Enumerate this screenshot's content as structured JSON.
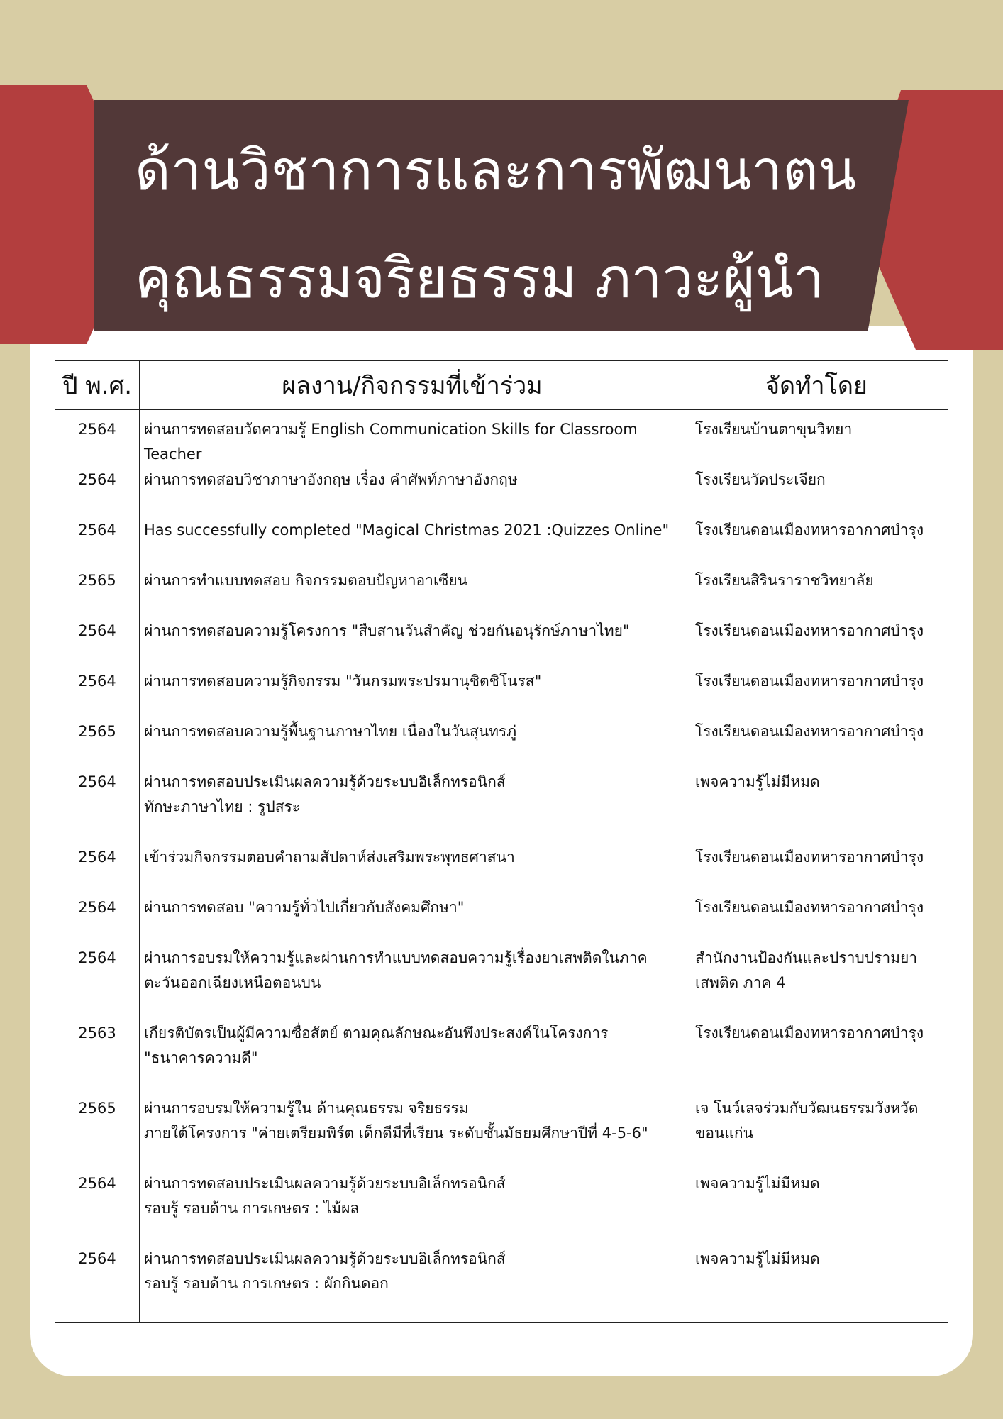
{
  "header": {
    "title_line1": "ด้านวิชาการและการพัฒนาตน",
    "title_line2": "คุณธรรมจริยธรรม ภาวะผู้นำ"
  },
  "table": {
    "columns": [
      "ปี พ.ศ.",
      "ผลงาน/กิจกรรมที่เข้าร่วม",
      "จัดทำโดย"
    ],
    "rows": [
      {
        "year": "2564",
        "activity": [
          "ผ่านการทดสอบวัดความรู้ English Communication Skills for Classroom",
          "Teacher"
        ],
        "organizer": [
          "โรงเรียนบ้านตาขุนวิทยา"
        ]
      },
      {
        "year": "2564",
        "activity": [
          "ผ่านการทดสอบวิชาภาษาอังกฤษ เรื่อง คำศัพท์ภาษาอังกฤษ"
        ],
        "organizer": [
          "โรงเรียนวัดประเจียก"
        ]
      },
      {
        "year": "2564",
        "activity": [
          "Has successfully completed \"Magical Christmas 2021 :Quizzes Online\""
        ],
        "organizer": [
          "โรงเรียนดอนเมืองทหารอากาศบำรุง"
        ]
      },
      {
        "year": "2565",
        "activity": [
          "ผ่านการทำแบบทดสอบ กิจกรรมตอบปัญหาอาเซียน"
        ],
        "organizer": [
          "โรงเรียนสิรินราราชวิทยาลัย"
        ]
      },
      {
        "year": "2564",
        "activity": [
          "ผ่านการทดสอบความรู้โครงการ \"สืบสานวันสำคัญ ช่วยกันอนุรักษ์ภาษาไทย\""
        ],
        "organizer": [
          "โรงเรียนดอนเมืองทหารอากาศบำรุง"
        ]
      },
      {
        "year": "2564",
        "activity": [
          "ผ่านการทดสอบความรู้กิจกรรม \"วันกรมพระปรมานุชิตชิโนรส\""
        ],
        "organizer": [
          "โรงเรียนดอนเมืองทหารอากาศบำรุง"
        ]
      },
      {
        "year": "2565",
        "activity": [
          "ผ่านการทดสอบความรู้พื้นฐานภาษาไทย เนื่องในวันสุนทรภู่"
        ],
        "organizer": [
          "โรงเรียนดอนเมืองทหารอากาศบำรุง"
        ]
      },
      {
        "year": "2564",
        "activity": [
          "ผ่านการทดสอบประเมินผลความรู้ด้วยระบบอิเล็กทรอนิกส์",
          "ทักษะภาษาไทย : รูปสระ"
        ],
        "organizer": [
          "เพจความรู้ไม่มีหมด"
        ]
      },
      {
        "year": "2564",
        "activity": [
          "เข้าร่วมกิจกรรมตอบคำถามสัปดาห์ส่งเสริมพระพุทธศาสนา"
        ],
        "organizer": [
          "โรงเรียนดอนเมืองทหารอากาศบำรุง"
        ]
      },
      {
        "year": "2564",
        "activity": [
          "ผ่านการทดสอบ \"ความรู้ทั่วไปเกี่ยวกับสังคมศึกษา\""
        ],
        "organizer": [
          "โรงเรียนดอนเมืองทหารอากาศบำรุง"
        ]
      },
      {
        "year": "2564",
        "activity": [
          "ผ่านการอบรมให้ความรู้และผ่านการทำแบบทดสอบความรู้เรื่องยาเสพติดในภาค",
          "ตะวันออกเฉียงเหนือตอนบน"
        ],
        "organizer": [
          "สำนักงานป้องกันและปราบปรามยา",
          "เสพติด ภาค 4"
        ]
      },
      {
        "year": "2563",
        "activity": [
          "เกียรติบัตรเป็นผู้มีความซื่อสัตย์ ตามคุณลักษณะอันพึงประสงค์ในโครงการ",
          "\"ธนาคารความดี\""
        ],
        "organizer": [
          "โรงเรียนดอนเมืองทหารอากาศบำรุง"
        ]
      },
      {
        "year": "2565",
        "activity": [
          "ผ่านการอบรมให้ความรู้ใน ด้านคุณธรรม จริยธรรม",
          "ภายใต้โครงการ \"ค่ายเตรียมพิร์ต เด็กดีมีที่เรียน ระดับชั้นมัธยมศึกษาปีที่ 4-5-6\""
        ],
        "organizer": [
          "เจ โนว์เลจร่วมกับวัฒนธรรมวังหวัด",
          "ขอนแก่น"
        ]
      },
      {
        "year": "2564",
        "activity": [
          "ผ่านการทดสอบประเมินผลความรู้ด้วยระบบอิเล็กทรอนิกส์",
          "รอบรู้ รอบด้าน การเกษตร : ไม้ผล"
        ],
        "organizer": [
          "เพจความรู้ไม่มีหมด"
        ]
      },
      {
        "year": "2564",
        "activity": [
          "ผ่านการทดสอบประเมินผลความรู้ด้วยระบบอิเล็กทรอนิกส์",
          "รอบรู้ รอบด้าน การเกษตร : ผักกินดอก"
        ],
        "organizer": [
          "เพจความรู้ไม่มีหมด"
        ]
      }
    ]
  },
  "colors": {
    "background": "#d8cda4",
    "banner": "#523838",
    "banner_wings": "#b33e3e",
    "card": "#ffffff"
  }
}
